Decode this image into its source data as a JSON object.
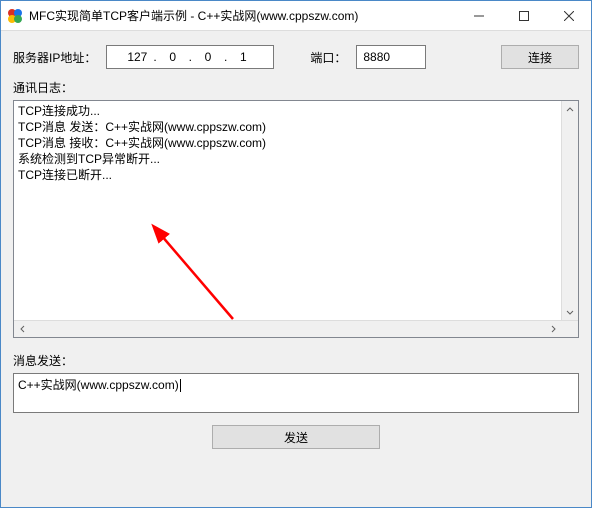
{
  "window": {
    "title": "MFC实现简单TCP客户端示例 - C++实战网(www.cppszw.com)"
  },
  "server": {
    "ip_label": "服务器IP地址：",
    "ip_octets": [
      "127",
      "0",
      "0",
      "1"
    ],
    "port_label": "端口：",
    "port_value": "8880",
    "connect_label": "连接"
  },
  "log": {
    "label": "通讯日志：",
    "lines": [
      "TCP连接成功...",
      "TCP消息 发送：C++实战网(www.cppszw.com)",
      "TCP消息 接收：C++实战网(www.cppszw.com)",
      "系统检测到TCP异常断开...",
      "TCP连接已断开..."
    ]
  },
  "message": {
    "label": "消息发送：",
    "input_value": "C++实战网(www.cppszw.com)",
    "send_label": "发送"
  }
}
